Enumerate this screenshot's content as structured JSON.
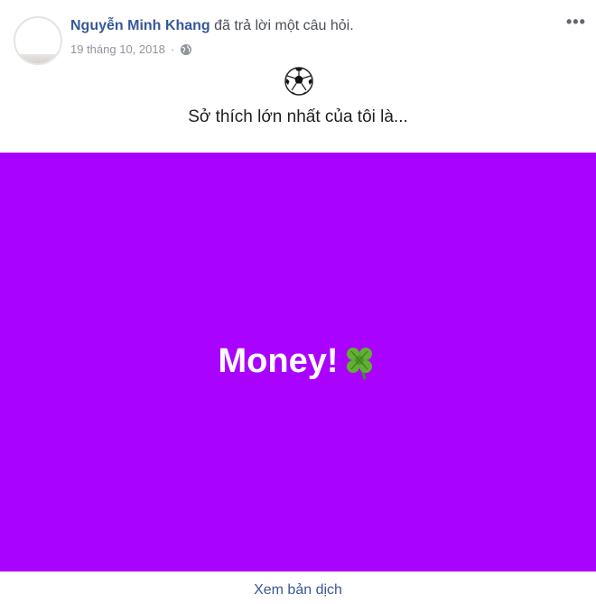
{
  "post": {
    "author": "Nguyễn Minh Khang",
    "action": "đã trả lời một câu hỏi.",
    "date": "19 tháng 10, 2018",
    "separator": "·",
    "privacy_icon": "globe-icon",
    "more_label": "•••",
    "question_icon": "soccer-ball-icon",
    "question": "Sở thích lớn nhất của tôi là...",
    "answer_text": "Money!",
    "answer_emoji": "four-leaf-clover-icon",
    "card_color": "#aa02ff",
    "translate_label": "Xem bản dịch"
  }
}
